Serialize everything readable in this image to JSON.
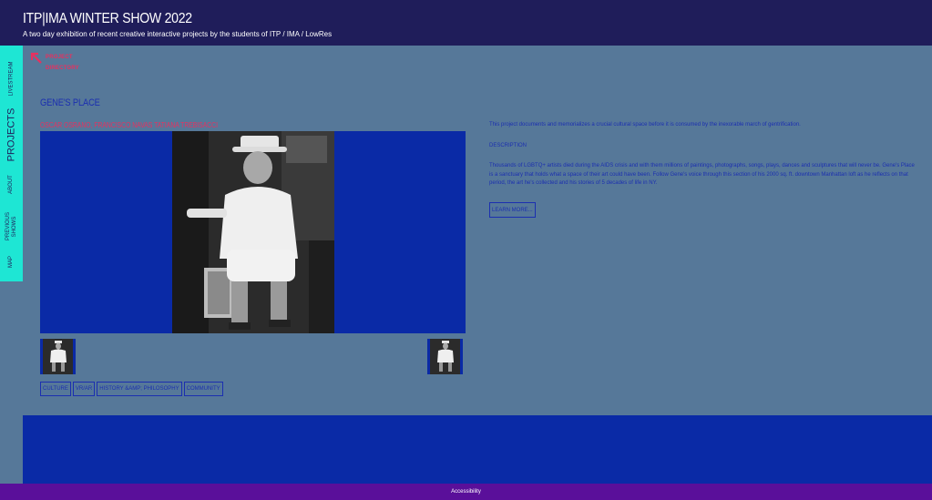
{
  "header": {
    "title": "ITP|IMA WINTER SHOW 2022",
    "subtitle": "A two day exhibition of recent creative interactive projects by the students of ITP / IMA / LowRes"
  },
  "sidenav": {
    "items": [
      {
        "label": "LIVESTREAM"
      },
      {
        "label": "PROJECTS"
      },
      {
        "label": "ABOUT"
      },
      {
        "label": "PREVIOUS SHOWS"
      },
      {
        "label": "MAP"
      }
    ]
  },
  "back_link": {
    "label_line1": "PROJECT",
    "label_line2": "DIRECTORY"
  },
  "project": {
    "title": "GENE'S PLACE",
    "authors": "OSCAR OSRANO, FRANCISCO NAVAS TATIANA TREBISACCI",
    "summary": "This project documents and memorializes a crucial cultural space before it is consumed by the inexorable march of gentrification.",
    "description_heading": "DESCRIPTION",
    "description": "Thousands of LGBTQ+ artists died during the AIDS crisis and with them millions of paintings, photographs, songs, plays, dances and sculptures that will never be. Gene's Place is a sanctuary that holds what a space of their art could have been. Follow Gene's voice through this section of his 2000 sq. ft. downtown Manhattan loft as he reflects on that period, the art he's collected and his stories of 5 decades of life in NY.",
    "learn_more": "LEARN MORE...",
    "tags": [
      "CULTURE",
      "VR/AR",
      "HISTORY &AMP; PHILOSOPHY",
      "COMMUNITY"
    ]
  },
  "footer": {
    "accessibility": "Accessibility"
  },
  "colors": {
    "header_bg": "#1f1d5a",
    "page_bg": "#567899",
    "sidenav_bg": "#1ee6d4",
    "accent_pink": "#e8305f",
    "link_blue": "#1b2fb0",
    "image_bg": "#0a2aa6",
    "access_bar": "#5a0f9a"
  },
  "icons": {
    "back": "arrow-up-left-icon"
  }
}
